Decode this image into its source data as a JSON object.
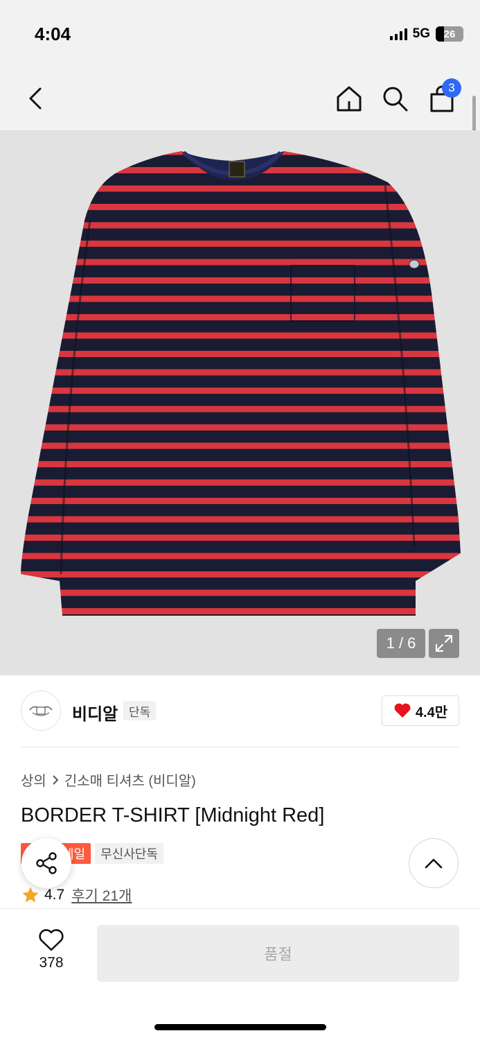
{
  "status_bar": {
    "time": "4:04",
    "network": "5G",
    "battery": "26"
  },
  "nav": {
    "back_icon": "chevron-left-icon",
    "home_icon": "home-icon",
    "search_icon": "search-icon",
    "cart_icon": "shopping-bag-icon",
    "cart_count": "3"
  },
  "gallery": {
    "counter": "1 / 6",
    "expand_icon": "expand-icon"
  },
  "brand": {
    "name": "비디알",
    "tag": "단독",
    "like_count": "4.4만"
  },
  "breadcrumb": {
    "category": "상의",
    "subcategory": "긴소매 티셔츠 (비디알)"
  },
  "product": {
    "title": "BORDER T-SHIRT [Midnight Red]",
    "tags": [
      "세일",
      "무신사단독"
    ],
    "rating": "4.7",
    "review_label": "후기 21개"
  },
  "bottom_bar": {
    "wish_count": "378",
    "purchase_label": "품절"
  },
  "colors": {
    "accent_blue": "#2f6af5",
    "sale_red": "#ff5a3d",
    "heart_red": "#e8131c",
    "star_orange": "#f5a623",
    "stripe_navy": "#1a1c33",
    "stripe_red": "#d9363e"
  }
}
